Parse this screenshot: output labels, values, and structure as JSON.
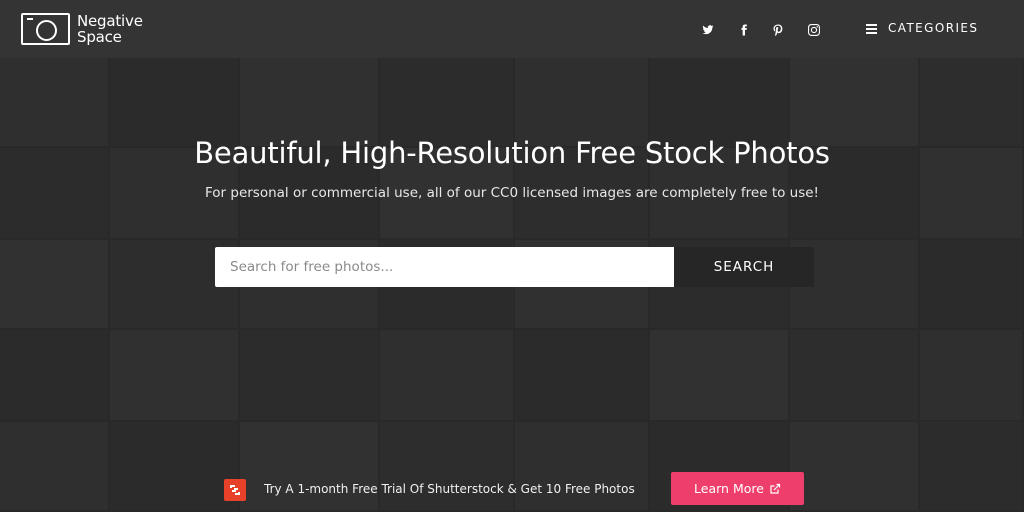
{
  "brand": {
    "name_line1": "Negative",
    "name_line2": "Space"
  },
  "nav": {
    "social": [
      {
        "icon": "twitter-icon"
      },
      {
        "icon": "facebook-icon"
      },
      {
        "icon": "pinterest-icon"
      },
      {
        "icon": "instagram-icon"
      }
    ],
    "categories_label": "CATEGORIES"
  },
  "hero": {
    "title": "Beautiful, High-Resolution Free Stock Photos",
    "subtitle": "For personal or commercial use, all of our CC0 licensed images are completely free to use!",
    "search": {
      "placeholder": "Search for free photos...",
      "value": "",
      "button_label": "SEARCH"
    }
  },
  "promo": {
    "text": "Try A 1-month Free Trial Of Shutterstock & Get 10 Free Photos",
    "button_label": "Learn More"
  },
  "colors": {
    "navbar_bg": "#343434",
    "hero_bg": "#303030",
    "search_button_bg": "#262626",
    "cta_pink": "#ee3e6b",
    "shutterstock_red": "#e8412a"
  }
}
